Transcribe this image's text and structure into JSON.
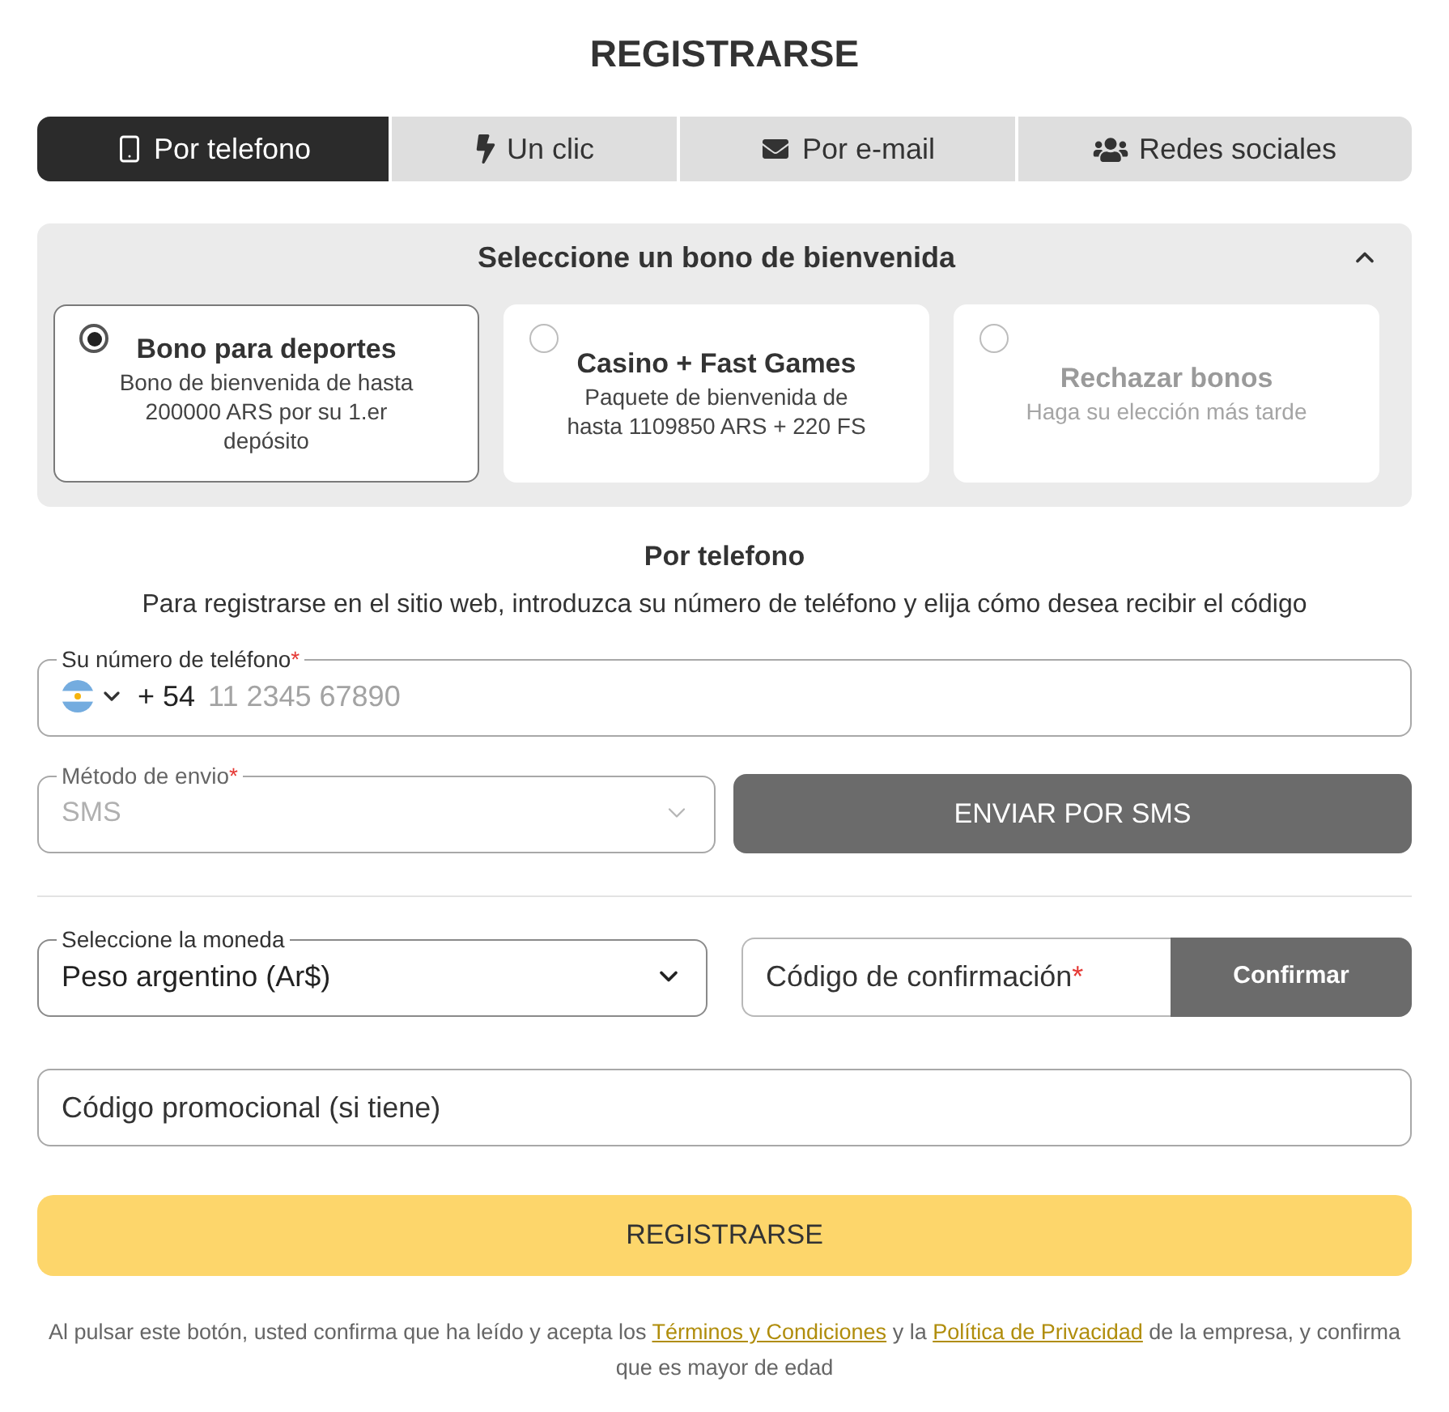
{
  "title": "REGISTRARSE",
  "tabs": [
    {
      "label": "Por telefono",
      "selected": true
    },
    {
      "label": "Un clic",
      "selected": false
    },
    {
      "label": "Por e-mail",
      "selected": false
    },
    {
      "label": "Redes sociales",
      "selected": false
    }
  ],
  "bonus": {
    "heading": "Seleccione un bono de bienvenida",
    "expanded": true,
    "options": [
      {
        "kind": "bonus",
        "title": "Bono para deportes",
        "description": "Bono de bienvenida de hasta 200000 ARS por su 1.er depósito",
        "selected": true
      },
      {
        "kind": "bonus",
        "title": "Casino + Fast Games",
        "description": "Paquete de bienvenida de hasta 1109850 ARS + 220 FS",
        "selected": false
      },
      {
        "kind": "decline",
        "title": "Rechazar bonos",
        "description": "Haga su elección más tarde",
        "selected": false
      }
    ]
  },
  "form": {
    "heading": "Por telefono",
    "intro": "Para registrarse en el sitio web, introduzca su número de teléfono y elija cómo desea recibir el código",
    "phone": {
      "label": "Su número de teléfono",
      "required_mark": "*",
      "code": "+ 54",
      "placeholder": "11 2345 67890"
    },
    "send_method": {
      "label": "Método de envio",
      "required_mark": "*",
      "value": "SMS",
      "disabled": true
    },
    "send_button": "ENVIAR POR SMS",
    "currency": {
      "label": "Seleccione la moneda",
      "value": "Peso argentino (Ar$)"
    },
    "confirmation": {
      "placeholder": "Código de confirmación",
      "required_mark": "*",
      "button": "Confirmar"
    },
    "promo": {
      "placeholder": "Código promocional (si tiene)"
    },
    "submit": "REGISTRARSE",
    "legal": [
      {
        "kind": "text",
        "text": "Al pulsar este botón, usted confirma que ha leído y acepta los"
      },
      {
        "kind": "link",
        "text": "Términos y Condiciones"
      },
      {
        "kind": "text",
        "text": "y la"
      },
      {
        "kind": "link",
        "text": "Política de Privacidad"
      },
      {
        "kind": "text",
        "text": "de la empresa, y confirma que es mayor de edad"
      }
    ]
  }
}
